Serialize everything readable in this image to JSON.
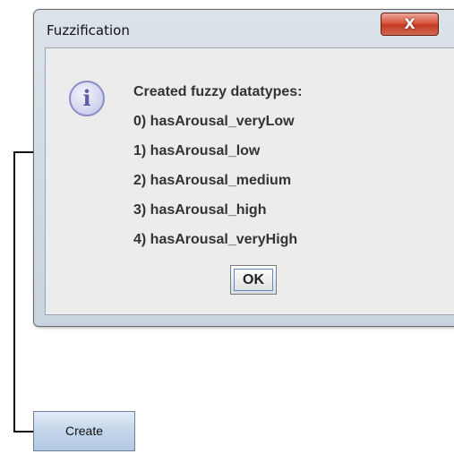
{
  "dialog": {
    "title": "Fuzzification",
    "close_label": "X",
    "icon": "information-icon",
    "icon_glyph": "i",
    "message_lines": [
      "Created fuzzy datatypes:",
      "0) hasArousal_veryLow",
      "1) hasArousal_low",
      "2) hasArousal_medium",
      "3) hasArousal_high",
      "4) hasArousal_veryHigh"
    ],
    "ok_label": "OK"
  },
  "main": {
    "create_label": "Create"
  },
  "colors": {
    "close_button": "#c23a23",
    "info_icon": "#8b8dc7",
    "create_button": "#c3d5ea"
  }
}
